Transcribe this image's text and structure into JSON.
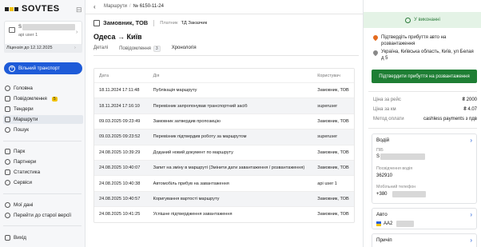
{
  "brand": {
    "name": "SOVTES"
  },
  "account": {
    "name_initial": "S",
    "user": "api user 1"
  },
  "license": {
    "text": "Ліцензія до 12.12.2025"
  },
  "sidebar": {
    "new_button": "Вільний транспорт",
    "items": [
      {
        "label": "Головна",
        "icon": "home-icon"
      },
      {
        "label": "Повідомлення",
        "icon": "bell-icon",
        "badge": "5"
      },
      {
        "label": "Тендери",
        "icon": "tender-icon"
      },
      {
        "label": "Маршрути",
        "icon": "route-icon"
      },
      {
        "label": "Пошук",
        "icon": "search-icon"
      },
      {
        "label": "Парк",
        "icon": "truck-icon"
      },
      {
        "label": "Партнери",
        "icon": "partners-icon"
      },
      {
        "label": "Статистика",
        "icon": "chart-icon"
      },
      {
        "label": "Сервіси",
        "icon": "services-icon"
      },
      {
        "label": "Мої дані",
        "icon": "profile-icon"
      },
      {
        "label": "Перейти до старої версії",
        "icon": "swap-icon"
      },
      {
        "label": "Вихід",
        "icon": "logout-icon"
      }
    ]
  },
  "breadcrumb": {
    "root": "Маршрути",
    "current": "№ 6150-11-24"
  },
  "header": {
    "company": "Замовник, ТОВ",
    "payer_label": "Платник",
    "payer_value": "ТД Заказчик",
    "route": "Одеса → Київ"
  },
  "tabs": [
    {
      "label": "Деталі",
      "active": false
    },
    {
      "label": "Повідомлення",
      "count": "3",
      "active": false
    },
    {
      "label": "Хронологія",
      "active": true
    }
  ],
  "table": {
    "columns": [
      "Дата",
      "Дія",
      "Користувач"
    ],
    "rows": [
      {
        "date": "18.11.2024 17:11:48",
        "action": "Публікація маршруту",
        "user": "Замовник, ТОВ"
      },
      {
        "date": "18.11.2024 17:16:10",
        "action": "Перевізник запропонував транспортний засіб",
        "user": "superuser"
      },
      {
        "date": "09.03.2025 09:23:49",
        "action": "Замовник затвердив пропозицію",
        "user": "Замовник, ТОВ"
      },
      {
        "date": "09.03.2025 09:23:52",
        "action": "Перевізник підтвердив роботу за маршрутом",
        "user": "superuser"
      },
      {
        "date": "24.08.2025 10:39:29",
        "action": "Доданий новий документ по маршруту",
        "user": "Замовник, ТОВ"
      },
      {
        "date": "24.08.2025 10:40:07",
        "action": "Запит на зміну в маршруті (Змінити дати завантаження / розвантаження)",
        "user": "Замовник, ТОВ"
      },
      {
        "date": "24.08.2025 10:40:38",
        "action": "Автомобіль прибув на завантаження",
        "user": "api user 1"
      },
      {
        "date": "24.08.2025 10:40:57",
        "action": "Коригування вартості маршруту",
        "user": "Замовник, ТОВ"
      },
      {
        "date": "24.08.2025 10:41:25",
        "action": "Успішне підтвердження завантаження",
        "user": "Замовник, ТОВ"
      }
    ]
  },
  "panel": {
    "status": "У виконанні",
    "alert": "Підтвердіть прибуття авто на розвантаження",
    "address": "Україна, Київська область, Київ, ул Белая д 5",
    "confirm_button": "Підтвердити прибуття на розвантаження",
    "price_trip_label": "Ціна за рейс",
    "price_trip_value": "₴ 2000",
    "price_km_label": "Ціна за км",
    "price_km_value": "₴ 4.07",
    "payment_label": "Метод оплати",
    "payment_value": "cashless payments з пдв",
    "driver_title": "Водій",
    "driver_name_label": "ПІБ",
    "driver_name_initial": "S",
    "license_label": "Посвідчення водія",
    "license_value": "362910",
    "phone_label": "Мобільний телефон",
    "phone_prefix": "+380",
    "auto_title": "Авто",
    "auto_plate_prefix": "AA2",
    "trailer_title": "Причіп"
  },
  "colors": {
    "accent_blue": "#1e5bd8",
    "confirm_green": "#1e7e34",
    "status_bg": "#e4f3e6",
    "badge_yellow": "#f2c200"
  }
}
